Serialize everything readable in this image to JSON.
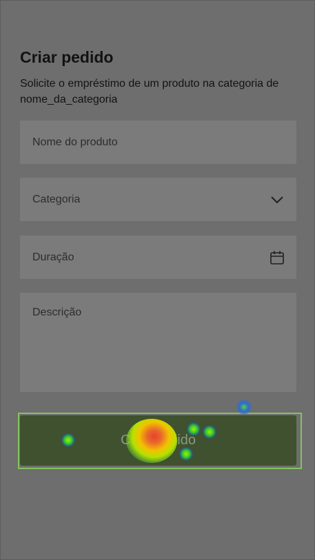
{
  "page": {
    "title": "Criar pedido",
    "subtitle": "Solicite o empréstimo de um produto na categoria de nome_da_categoria"
  },
  "form": {
    "product_name_placeholder": "Nome do produto",
    "category_placeholder": "Categoria",
    "duration_placeholder": "Duração",
    "description_placeholder": "Descrição",
    "submit_label": "Criar pedido"
  },
  "icons": {
    "category_dropdown": "chevron-down-icon",
    "duration_picker": "calendar-icon"
  },
  "colors": {
    "background": "#6e6e6e",
    "field": "#7b7b7b",
    "submit_button": "#3f512e",
    "highlight": "#84c45c"
  }
}
